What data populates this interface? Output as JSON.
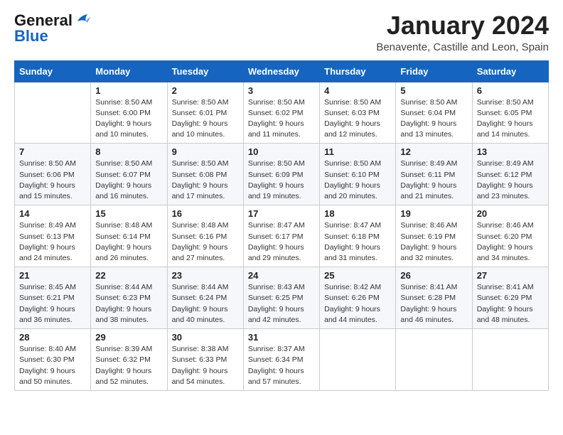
{
  "header": {
    "logo_general": "General",
    "logo_blue": "Blue",
    "month_title": "January 2024",
    "location": "Benavente, Castille and Leon, Spain"
  },
  "days_of_week": [
    "Sunday",
    "Monday",
    "Tuesday",
    "Wednesday",
    "Thursday",
    "Friday",
    "Saturday"
  ],
  "weeks": [
    [
      {
        "day": "",
        "info": ""
      },
      {
        "day": "1",
        "info": "Sunrise: 8:50 AM\nSunset: 6:00 PM\nDaylight: 9 hours\nand 10 minutes."
      },
      {
        "day": "2",
        "info": "Sunrise: 8:50 AM\nSunset: 6:01 PM\nDaylight: 9 hours\nand 10 minutes."
      },
      {
        "day": "3",
        "info": "Sunrise: 8:50 AM\nSunset: 6:02 PM\nDaylight: 9 hours\nand 11 minutes."
      },
      {
        "day": "4",
        "info": "Sunrise: 8:50 AM\nSunset: 6:03 PM\nDaylight: 9 hours\nand 12 minutes."
      },
      {
        "day": "5",
        "info": "Sunrise: 8:50 AM\nSunset: 6:04 PM\nDaylight: 9 hours\nand 13 minutes."
      },
      {
        "day": "6",
        "info": "Sunrise: 8:50 AM\nSunset: 6:05 PM\nDaylight: 9 hours\nand 14 minutes."
      }
    ],
    [
      {
        "day": "7",
        "info": "Sunrise: 8:50 AM\nSunset: 6:06 PM\nDaylight: 9 hours\nand 15 minutes."
      },
      {
        "day": "8",
        "info": "Sunrise: 8:50 AM\nSunset: 6:07 PM\nDaylight: 9 hours\nand 16 minutes."
      },
      {
        "day": "9",
        "info": "Sunrise: 8:50 AM\nSunset: 6:08 PM\nDaylight: 9 hours\nand 17 minutes."
      },
      {
        "day": "10",
        "info": "Sunrise: 8:50 AM\nSunset: 6:09 PM\nDaylight: 9 hours\nand 19 minutes."
      },
      {
        "day": "11",
        "info": "Sunrise: 8:50 AM\nSunset: 6:10 PM\nDaylight: 9 hours\nand 20 minutes."
      },
      {
        "day": "12",
        "info": "Sunrise: 8:49 AM\nSunset: 6:11 PM\nDaylight: 9 hours\nand 21 minutes."
      },
      {
        "day": "13",
        "info": "Sunrise: 8:49 AM\nSunset: 6:12 PM\nDaylight: 9 hours\nand 23 minutes."
      }
    ],
    [
      {
        "day": "14",
        "info": "Sunrise: 8:49 AM\nSunset: 6:13 PM\nDaylight: 9 hours\nand 24 minutes."
      },
      {
        "day": "15",
        "info": "Sunrise: 8:48 AM\nSunset: 6:14 PM\nDaylight: 9 hours\nand 26 minutes."
      },
      {
        "day": "16",
        "info": "Sunrise: 8:48 AM\nSunset: 6:16 PM\nDaylight: 9 hours\nand 27 minutes."
      },
      {
        "day": "17",
        "info": "Sunrise: 8:47 AM\nSunset: 6:17 PM\nDaylight: 9 hours\nand 29 minutes."
      },
      {
        "day": "18",
        "info": "Sunrise: 8:47 AM\nSunset: 6:18 PM\nDaylight: 9 hours\nand 31 minutes."
      },
      {
        "day": "19",
        "info": "Sunrise: 8:46 AM\nSunset: 6:19 PM\nDaylight: 9 hours\nand 32 minutes."
      },
      {
        "day": "20",
        "info": "Sunrise: 8:46 AM\nSunset: 6:20 PM\nDaylight: 9 hours\nand 34 minutes."
      }
    ],
    [
      {
        "day": "21",
        "info": "Sunrise: 8:45 AM\nSunset: 6:21 PM\nDaylight: 9 hours\nand 36 minutes."
      },
      {
        "day": "22",
        "info": "Sunrise: 8:44 AM\nSunset: 6:23 PM\nDaylight: 9 hours\nand 38 minutes."
      },
      {
        "day": "23",
        "info": "Sunrise: 8:44 AM\nSunset: 6:24 PM\nDaylight: 9 hours\nand 40 minutes."
      },
      {
        "day": "24",
        "info": "Sunrise: 8:43 AM\nSunset: 6:25 PM\nDaylight: 9 hours\nand 42 minutes."
      },
      {
        "day": "25",
        "info": "Sunrise: 8:42 AM\nSunset: 6:26 PM\nDaylight: 9 hours\nand 44 minutes."
      },
      {
        "day": "26",
        "info": "Sunrise: 8:41 AM\nSunset: 6:28 PM\nDaylight: 9 hours\nand 46 minutes."
      },
      {
        "day": "27",
        "info": "Sunrise: 8:41 AM\nSunset: 6:29 PM\nDaylight: 9 hours\nand 48 minutes."
      }
    ],
    [
      {
        "day": "28",
        "info": "Sunrise: 8:40 AM\nSunset: 6:30 PM\nDaylight: 9 hours\nand 50 minutes."
      },
      {
        "day": "29",
        "info": "Sunrise: 8:39 AM\nSunset: 6:32 PM\nDaylight: 9 hours\nand 52 minutes."
      },
      {
        "day": "30",
        "info": "Sunrise: 8:38 AM\nSunset: 6:33 PM\nDaylight: 9 hours\nand 54 minutes."
      },
      {
        "day": "31",
        "info": "Sunrise: 8:37 AM\nSunset: 6:34 PM\nDaylight: 9 hours\nand 57 minutes."
      },
      {
        "day": "",
        "info": ""
      },
      {
        "day": "",
        "info": ""
      },
      {
        "day": "",
        "info": ""
      }
    ]
  ]
}
